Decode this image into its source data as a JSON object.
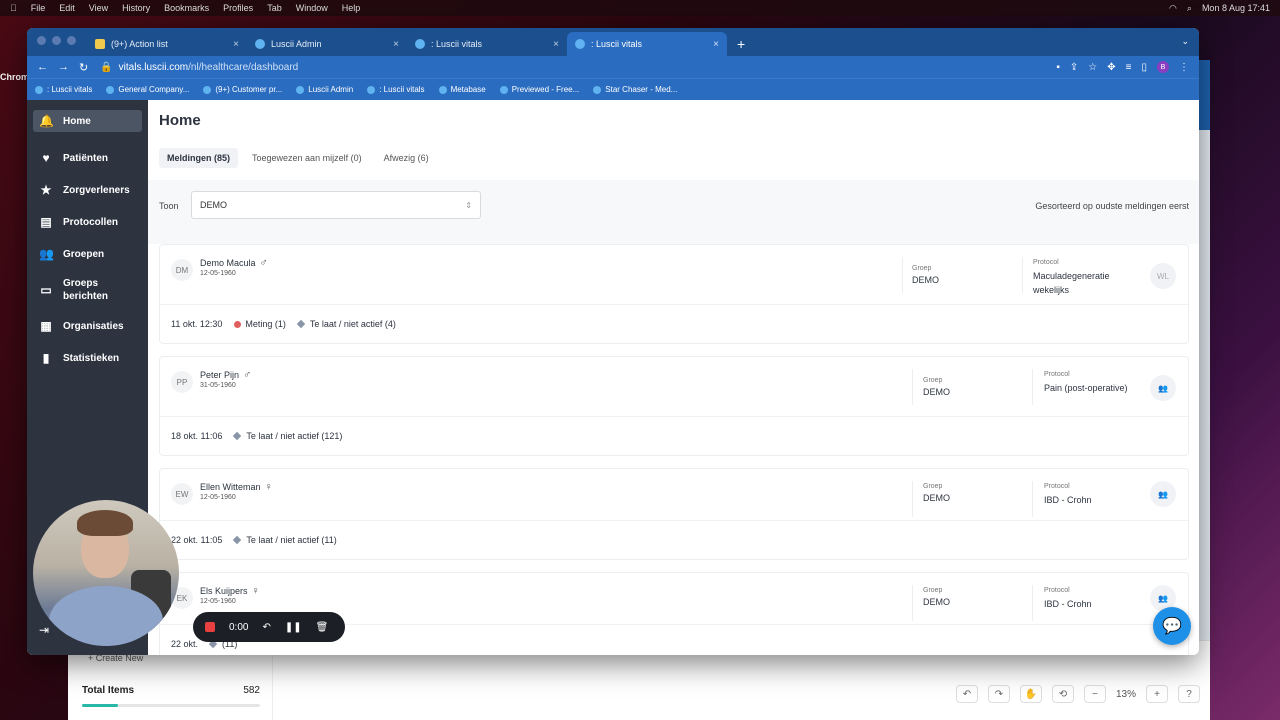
{
  "menubar": {
    "app": "Chrome",
    "items": [
      "File",
      "Edit",
      "View",
      "History",
      "Bookmarks",
      "Profiles",
      "Tab",
      "Window",
      "Help"
    ],
    "clock": "Mon 8 Aug  17:41"
  },
  "browser": {
    "tabs": [
      {
        "label": "(9+) Action list",
        "active": false
      },
      {
        "label": "Luscii Admin",
        "active": false
      },
      {
        "label": ": Luscii vitals",
        "active": false
      },
      {
        "label": ": Luscii vitals",
        "active": true
      }
    ],
    "url_host": "vitals.luscii.com",
    "url_path": "/nl/healthcare/dashboard",
    "profile_initial": "B",
    "bookmarks": [
      ": Luscii vitals",
      "General Company...",
      "(9+) Customer pr...",
      "Luscii Admin",
      ": Luscii vitals",
      "Metabase",
      "Previewed - Free...",
      "Star Chaser - Med..."
    ]
  },
  "sidebar": {
    "items": [
      {
        "label": "Home",
        "icon": "bell-icon",
        "glyph": "🔔"
      },
      {
        "label": "Patiënten",
        "icon": "heart-icon",
        "glyph": "♥"
      },
      {
        "label": "Zorgverleners",
        "icon": "star-icon",
        "glyph": "★"
      },
      {
        "label": "Protocollen",
        "icon": "document-icon",
        "glyph": "▤"
      },
      {
        "label": "Groepen",
        "icon": "group-icon",
        "glyph": "👥"
      },
      {
        "label": "Groeps\nberichten",
        "line1": "Groeps",
        "line2": "berichten",
        "icon": "message-icon",
        "glyph": "▭"
      },
      {
        "label": "Organisaties",
        "icon": "grid-icon",
        "glyph": "▦"
      },
      {
        "label": "Statistieken",
        "icon": "bar-chart-icon",
        "glyph": "▮"
      }
    ]
  },
  "main": {
    "title": "Home",
    "tabs": [
      {
        "label": "Meldingen (85)",
        "active": true
      },
      {
        "label": "Toegewezen aan mijzelf (0)",
        "active": false
      },
      {
        "label": "Afwezig (6)",
        "active": false
      }
    ],
    "filter_label": "Toon",
    "filter_value": "DEMO",
    "sort_note": "Gesorteerd op oudste meldingen eerst",
    "group_label": "Groep",
    "protocol_label": "Protocol",
    "cards": [
      {
        "initials": "DM",
        "name": "Demo Macula",
        "sex": "♂",
        "dob": "12-05-1960",
        "group": "DEMO",
        "protocol": "Maculadegeneratie wekelijks",
        "assignee": "WL",
        "time": "11 okt. 12:30",
        "tags": [
          {
            "kind": "dot",
            "label": "Meting (1)"
          },
          {
            "kind": "diamond",
            "label": "Te laat / niet actief (4)"
          }
        ]
      },
      {
        "initials": "PP",
        "name": "Peter Pijn",
        "sex": "♂",
        "dob": "31-05-1960",
        "group": "DEMO",
        "protocol": "Pain (post-operative)",
        "assignee": "",
        "time": "18 okt. 11:06",
        "tags": [
          {
            "kind": "diamond",
            "label": "Te laat / niet actief (121)"
          }
        ]
      },
      {
        "initials": "EW",
        "name": "Ellen Witteman",
        "sex": "♀",
        "dob": "12-05-1960",
        "group": "DEMO",
        "protocol": "IBD - Crohn",
        "assignee": "",
        "time": "22 okt. 11:05",
        "tags": [
          {
            "kind": "diamond",
            "label": "Te laat / niet actief (11)"
          }
        ]
      },
      {
        "initials": "EK",
        "name": "Els Kuijpers",
        "sex": "♀",
        "dob": "12-05-1960",
        "group": "DEMO",
        "protocol": "IBD - Crohn",
        "assignee": "",
        "time": "22 okt.",
        "tags": [
          {
            "kind": "diamond",
            "label": "(11)"
          }
        ]
      }
    ]
  },
  "background_app": {
    "create_new": "+ Create New",
    "total_items_label": "Total Items",
    "total_items_value": "582",
    "progress": 0.2,
    "zoom": "13%"
  },
  "recorder": {
    "time": "0:00"
  }
}
